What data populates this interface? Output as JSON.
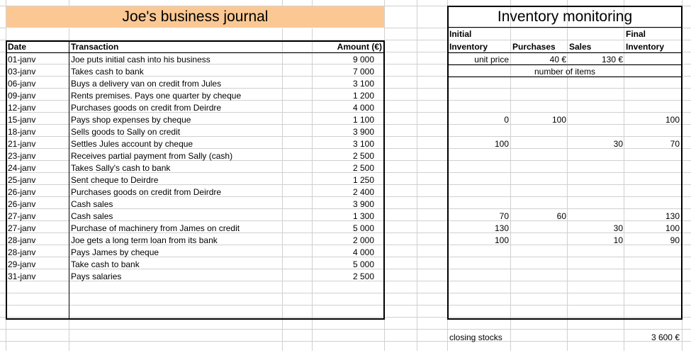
{
  "journal": {
    "title": "Joe's business journal",
    "headers": {
      "date": "Date",
      "transaction": "Transaction",
      "amount": "Amount (€)"
    },
    "rows": [
      {
        "date": "01-janv",
        "transaction": "Joe puts initial cash into his business",
        "amount": "9 000"
      },
      {
        "date": "03-janv",
        "transaction": "Takes cash to bank",
        "amount": "7 000"
      },
      {
        "date": "06-janv",
        "transaction": "Buys a delivery van on credit from Jules",
        "amount": "3 100"
      },
      {
        "date": "09-janv",
        "transaction": "Rents premises. Pays one quarter by cheque",
        "amount": "1 200"
      },
      {
        "date": "12-janv",
        "transaction": "Purchases goods on credit from Deirdre",
        "amount": "4 000"
      },
      {
        "date": "15-janv",
        "transaction": "Pays shop expenses by cheque",
        "amount": "1 100"
      },
      {
        "date": "18-janv",
        "transaction": "Sells goods to Sally on credit",
        "amount": "3 900"
      },
      {
        "date": "21-janv",
        "transaction": "Settles Jules account by cheque",
        "amount": "3 100"
      },
      {
        "date": "23-janv",
        "transaction": "Receives partial payment from Sally (cash)",
        "amount": "2 500"
      },
      {
        "date": "24-janv",
        "transaction": "Takes Sally's cash to bank",
        "amount": "2 500"
      },
      {
        "date": "25-janv",
        "transaction": "Sent cheque to Deirdre",
        "amount": "1 250"
      },
      {
        "date": "26-janv",
        "transaction": "Purchases goods on credit from Deirdre",
        "amount": "2 400"
      },
      {
        "date": "26-janv",
        "transaction": "Cash sales",
        "amount": "3 900"
      },
      {
        "date": "27-janv",
        "transaction": "Cash sales",
        "amount": "1 300"
      },
      {
        "date": "27-janv",
        "transaction": "Purchase of machinery from James on credit",
        "amount": "5 000"
      },
      {
        "date": "28-janv",
        "transaction": "Joe gets a long term loan from its bank",
        "amount": "2 000"
      },
      {
        "date": "28-janv",
        "transaction": "Pays James by cheque",
        "amount": "4 000"
      },
      {
        "date": "29-janv",
        "transaction": "Take cash to bank",
        "amount": "5 000"
      },
      {
        "date": "31-janv",
        "transaction": "Pays salaries",
        "amount": "2 500"
      }
    ]
  },
  "inventory": {
    "title": "Inventory monitoring",
    "headers": {
      "initial_line1": "Initial",
      "initial_line2": "Inventory",
      "purchases": "Purchases",
      "sales": "Sales",
      "final_line1": "Final",
      "final_line2": "Inventory"
    },
    "unit_price_label": "unit price",
    "purchase_price": "40 €",
    "sale_price": "130 €",
    "number_of_items_label": "number of items",
    "rows": [
      {
        "initial": "",
        "purchases": "",
        "sales": "",
        "final": ""
      },
      {
        "initial": "0",
        "purchases": "100",
        "sales": "",
        "final": "100"
      },
      {
        "initial": "",
        "purchases": "",
        "sales": "",
        "final": ""
      },
      {
        "initial": "100",
        "purchases": "",
        "sales": "30",
        "final": "70"
      },
      {
        "initial": "",
        "purchases": "",
        "sales": "",
        "final": ""
      },
      {
        "initial": "",
        "purchases": "",
        "sales": "",
        "final": ""
      },
      {
        "initial": "",
        "purchases": "",
        "sales": "",
        "final": ""
      },
      {
        "initial": "",
        "purchases": "",
        "sales": "",
        "final": ""
      },
      {
        "initial": "",
        "purchases": "",
        "sales": "",
        "final": ""
      },
      {
        "initial": "70",
        "purchases": "60",
        "sales": "",
        "final": "130"
      },
      {
        "initial": "130",
        "purchases": "",
        "sales": "30",
        "final": "100"
      },
      {
        "initial": "100",
        "purchases": "",
        "sales": "10",
        "final": "90"
      }
    ],
    "closing_stocks_label": "closing stocks",
    "closing_stocks_value": "3 600 €"
  }
}
